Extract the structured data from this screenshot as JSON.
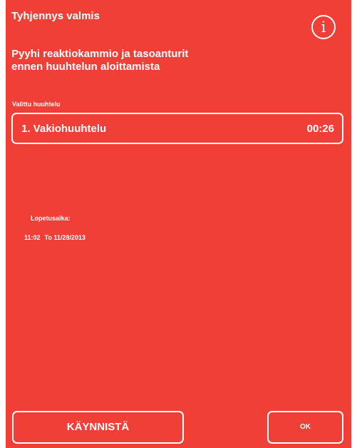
{
  "header": {
    "title": "Tyhjennys valmis",
    "info_icon": "info-icon",
    "info_glyph": "i"
  },
  "instruction": {
    "line1": "Pyyhi reaktiokammio ja tasoanturit",
    "line2": "ennen huuhtelun aloittamista"
  },
  "selected_rinse": {
    "label": "Valittu huuhtelu",
    "name": "1. Vakiohuuhtelu",
    "duration": "00:26"
  },
  "end_time": {
    "label": "Lopetusaika:",
    "time": "11:02",
    "date": "To 11/28/2013"
  },
  "buttons": {
    "start_label": "KÄYNNISTÄ",
    "ok_label": "OK"
  },
  "colors": {
    "background": "#ef3f37",
    "foreground": "#ffffff"
  }
}
